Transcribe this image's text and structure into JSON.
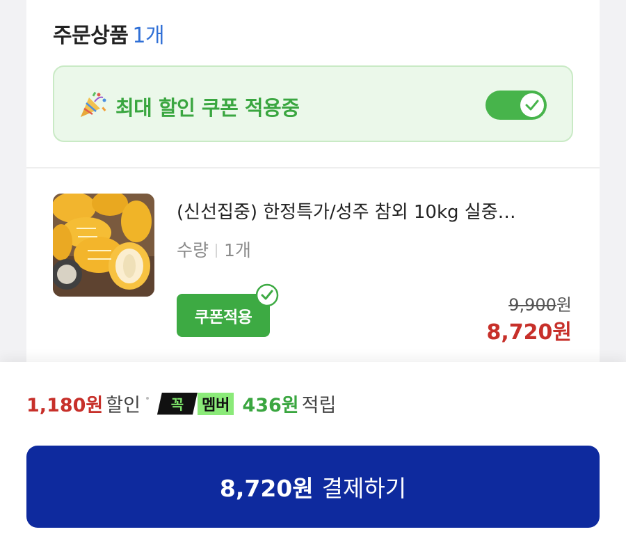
{
  "order_section": {
    "title": "주문상품",
    "count": "1개"
  },
  "coupon_banner": {
    "icon": "party-popper-icon",
    "text": "최대 할인 쿠폰 적용중",
    "toggle_on": true
  },
  "product": {
    "name": "(신선집중) 한정특가/성주 참외 10kg 실중…",
    "quantity_label": "수량",
    "quantity_value": "1개",
    "coupon_badge": "쿠폰적용",
    "original_price": "9,900",
    "final_price": "8,720",
    "currency": "원"
  },
  "summary": {
    "discount_amount": "1,180원",
    "discount_label": "할인",
    "member_logo": "꼭",
    "member_label": "멤버",
    "reward_amount": "436원",
    "reward_label": "적립"
  },
  "pay_button": {
    "amount": "8,720원",
    "label": "결제하기"
  },
  "colors": {
    "accent_green": "#3aa640",
    "price_red": "#c7302a",
    "pay_blue": "#0e2a9e",
    "count_blue": "#2f6fd6"
  }
}
